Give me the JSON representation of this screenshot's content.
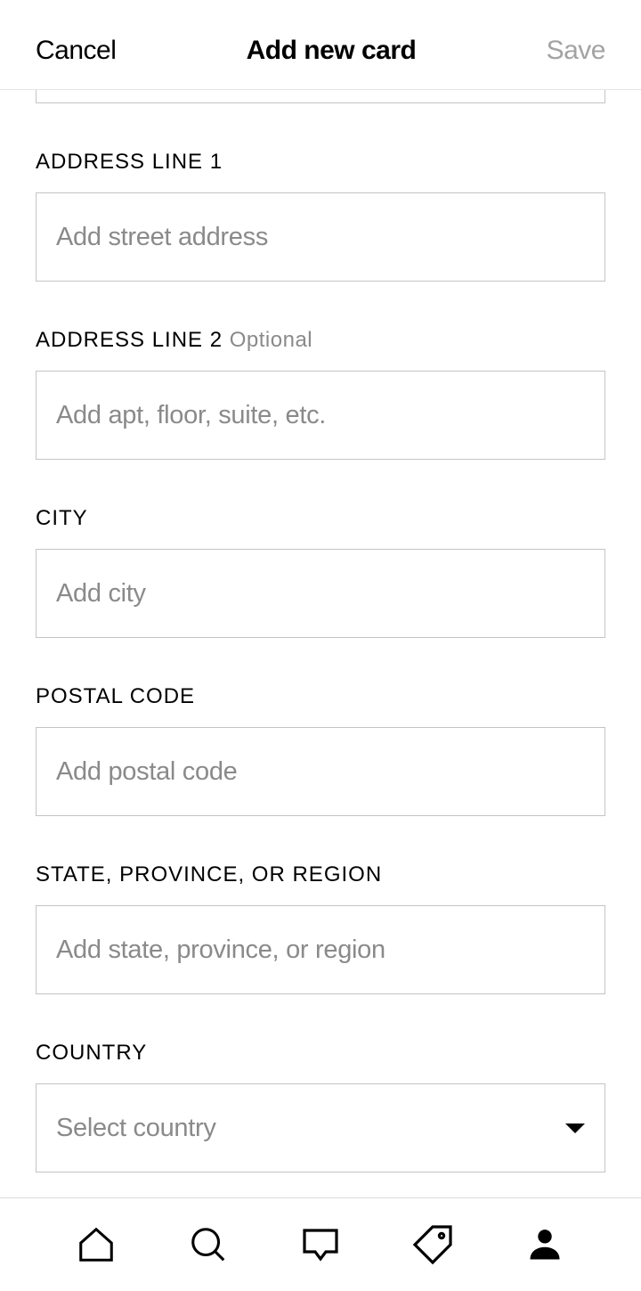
{
  "header": {
    "cancel_label": "Cancel",
    "title": "Add new card",
    "save_label": "Save"
  },
  "fields": {
    "address1": {
      "label": "ADDRESS LINE 1",
      "placeholder": "Add street address",
      "value": ""
    },
    "address2": {
      "label": "ADDRESS LINE 2",
      "optional": "Optional",
      "placeholder": "Add apt, floor, suite, etc.",
      "value": ""
    },
    "city": {
      "label": "CITY",
      "placeholder": "Add city",
      "value": ""
    },
    "postal": {
      "label": "POSTAL CODE",
      "placeholder": "Add postal code",
      "value": ""
    },
    "state": {
      "label": "STATE, PROVINCE, OR REGION",
      "placeholder": "Add state, province, or region",
      "value": ""
    },
    "country": {
      "label": "COUNTRY",
      "placeholder": "Select country",
      "value": ""
    }
  },
  "nav": {
    "home": "home-icon",
    "search": "search-icon",
    "inbox": "inbox-icon",
    "sell": "tag-icon",
    "profile": "profile-icon"
  }
}
